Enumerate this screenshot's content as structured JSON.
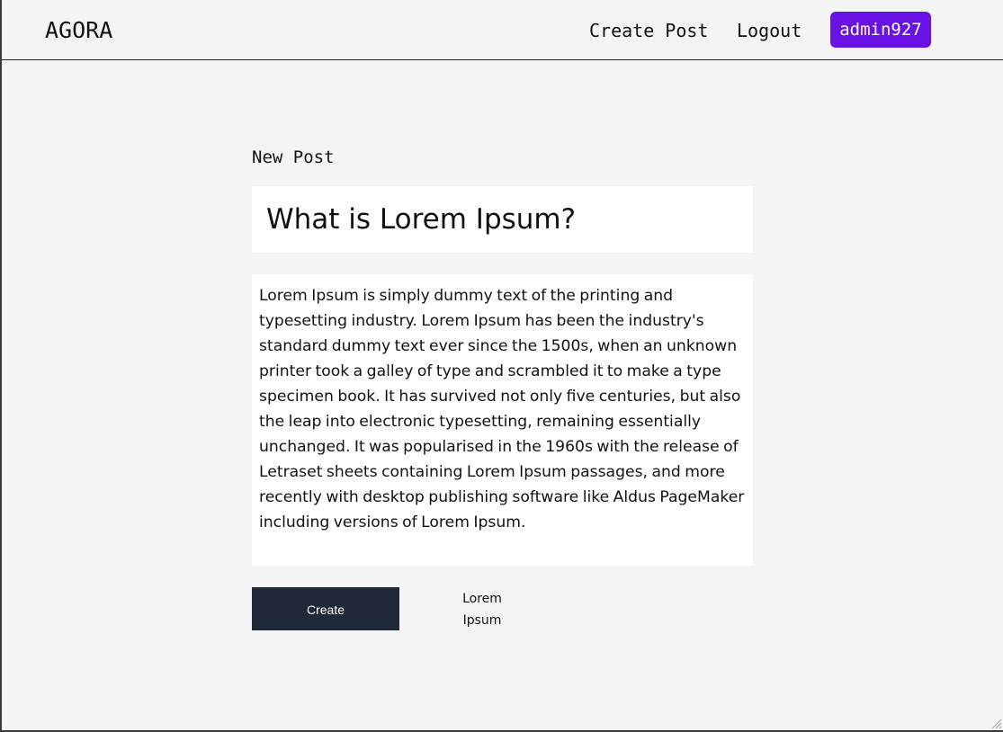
{
  "navbar": {
    "brand": "AGORA",
    "links": {
      "create_post": "Create Post",
      "logout": "Logout"
    },
    "username": "admin927",
    "badge_color": "#6a12e6"
  },
  "form": {
    "heading": "New Post",
    "title_value": "What is Lorem Ipsum?",
    "body_value": "Lorem Ipsum is simply dummy text of the printing and typesetting industry. Lorem Ipsum has been the industry's standard dummy text ever since the 1500s, when an unknown printer took a galley of type and scrambled it to make a type specimen book. It has survived not only five centuries, but also the leap into electronic typesetting, remaining essentially unchanged. It was popularised in the 1960s with the release of Letraset sheets containing Lorem Ipsum passages, and more recently with desktop publishing software like Aldus PageMaker including versions of Lorem Ipsum.",
    "create_label": "Create",
    "side_text": "Lorem Ipsum",
    "button_color": "#1f2937"
  },
  "icons": {
    "resize": "resize-grip-icon"
  }
}
